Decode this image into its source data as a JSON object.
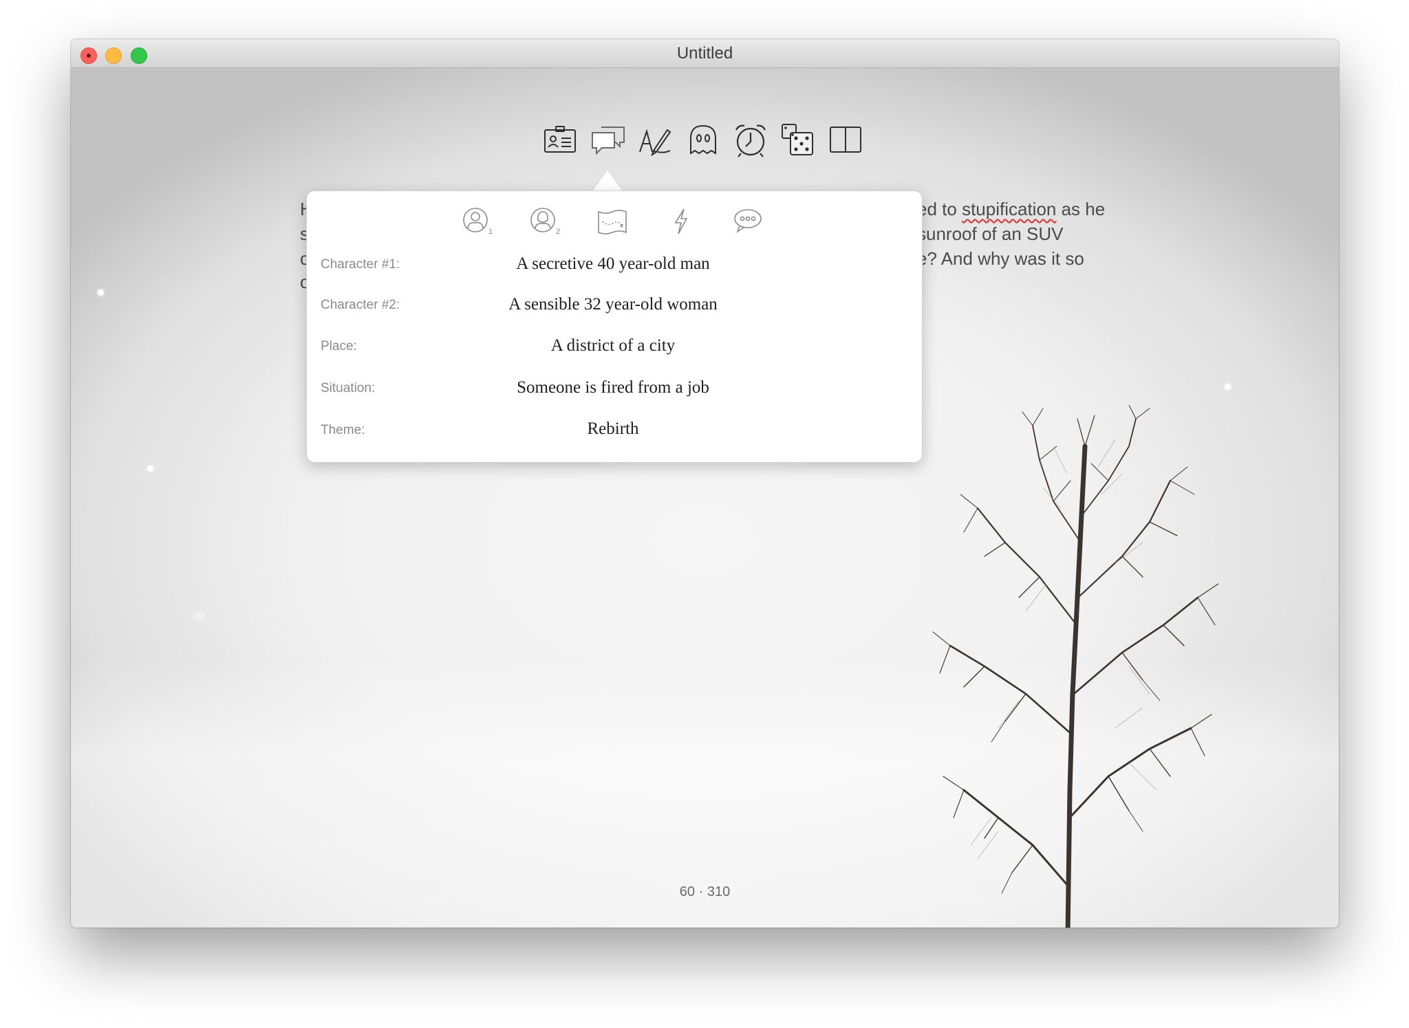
{
  "window": {
    "title": "Untitled"
  },
  "toolbar": {
    "icons": [
      "contact-card-icon",
      "speech-bubbles-icon",
      "pen-icon",
      "ghost-icon",
      "alarm-clock-icon",
      "dice-icon",
      "book-icon"
    ],
    "active": "speech-bubbles-icon"
  },
  "editor": {
    "line1_start": "H",
    "line1_end_a": "ed to ",
    "line1_misspelled": "stupification",
    "line1_end_b": " as he",
    "line2_start": "s",
    "line2_end": " sunroof of an SUV",
    "line3_start": "c",
    "line3_end": "e? And why was it so",
    "line4_start": "c"
  },
  "prompt_popover": {
    "tabs": [
      "character-one-icon",
      "character-two-icon",
      "map-icon",
      "lightning-icon",
      "chat-bubble-icon"
    ],
    "rows": [
      {
        "label": "Character #1:",
        "value": "A secretive 40 year-old man"
      },
      {
        "label": "Character #2:",
        "value": "A sensible 32 year-old woman"
      },
      {
        "label": "Place:",
        "value": "A district of a city"
      },
      {
        "label": "Situation:",
        "value": "Someone is fired from a job"
      },
      {
        "label": "Theme:",
        "value": "Rebirth"
      }
    ]
  },
  "status": {
    "word_count": "60 · 310"
  },
  "colors": {
    "close": "#fc605c",
    "minimize": "#fdbc40",
    "maximize": "#34c84a",
    "spellcheck": "#e0302a"
  }
}
